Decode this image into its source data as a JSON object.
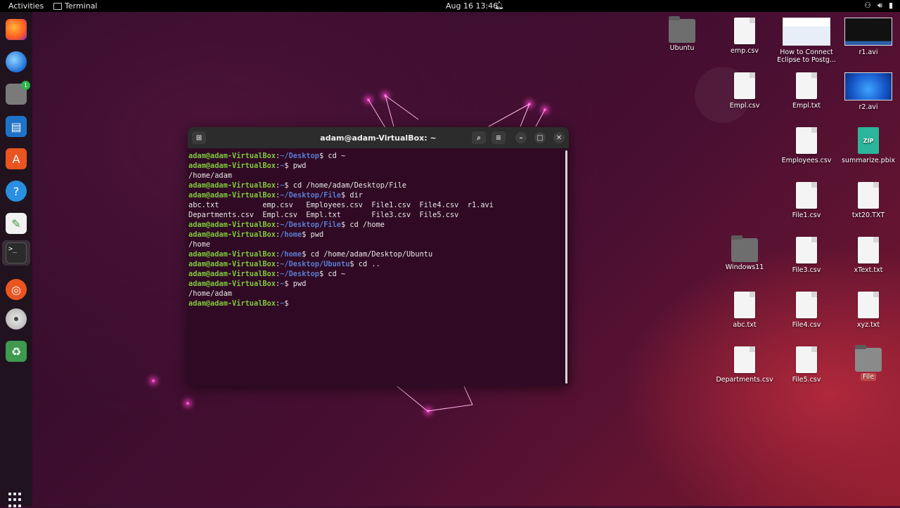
{
  "topbar": {
    "activities": "Activities",
    "app_name": "Terminal",
    "clock": "Aug 16  13:46"
  },
  "dock": {
    "items": [
      {
        "name": "firefox",
        "icon": "firefox-icon"
      },
      {
        "name": "thunderbird",
        "icon": "mail-icon"
      },
      {
        "name": "files",
        "icon": "files-icon",
        "badge": "1"
      },
      {
        "name": "writer",
        "icon": "writer-icon"
      },
      {
        "name": "software",
        "icon": "software-icon"
      },
      {
        "name": "help",
        "icon": "help-icon"
      },
      {
        "name": "text-editor",
        "icon": "text-editor-icon"
      },
      {
        "name": "terminal",
        "icon": "terminal-icon"
      },
      {
        "name": "ubuntu-pro",
        "icon": "ubuntu-icon"
      },
      {
        "name": "disc",
        "icon": "disc-icon"
      },
      {
        "name": "trash",
        "icon": "trash-icon"
      }
    ]
  },
  "terminal": {
    "title": "adam@adam-VirtualBox: ~",
    "lines": [
      {
        "user": "adam@adam-VirtualBox",
        "sep": ":",
        "path": "~/Desktop",
        "cmd": "$ cd ~"
      },
      {
        "user": "adam@adam-VirtualBox",
        "sep": ":",
        "path": "~",
        "cmd": "$ pwd"
      },
      {
        "text": "/home/adam"
      },
      {
        "user": "adam@adam-VirtualBox",
        "sep": ":",
        "path": "~",
        "cmd": "$ cd /home/adam/Desktop/File"
      },
      {
        "user": "adam@adam-VirtualBox",
        "sep": ":",
        "path": "~/Desktop/File",
        "cmd": "$ dir"
      },
      {
        "text": "abc.txt          emp.csv   Employees.csv  File1.csv  File4.csv  r1.avi"
      },
      {
        "text": "Departments.csv  Empl.csv  Empl.txt       File3.csv  File5.csv"
      },
      {
        "user": "adam@adam-VirtualBox",
        "sep": ":",
        "path": "~/Desktop/File",
        "cmd": "$ cd /home"
      },
      {
        "user": "adam@adam-VirtualBox",
        "sep": ":",
        "path": "/home",
        "cmd": "$ pwd"
      },
      {
        "text": "/home"
      },
      {
        "user": "adam@adam-VirtualBox",
        "sep": ":",
        "path": "/home",
        "cmd": "$ cd /home/adam/Desktop/Ubuntu"
      },
      {
        "user": "adam@adam-VirtualBox",
        "sep": ":",
        "path": "~/Desktop/Ubuntu",
        "cmd": "$ cd .."
      },
      {
        "user": "adam@adam-VirtualBox",
        "sep": ":",
        "path": "~/Desktop",
        "cmd": "$ cd ~"
      },
      {
        "user": "adam@adam-VirtualBox",
        "sep": ":",
        "path": "~",
        "cmd": "$ pwd"
      },
      {
        "text": "/home/adam"
      },
      {
        "user": "adam@adam-VirtualBox",
        "sep": ":",
        "path": "~",
        "cmd": "$ "
      }
    ]
  },
  "desktop": {
    "icons": [
      {
        "label": "Ubuntu",
        "kind": "folder"
      },
      {
        "label": "emp.csv",
        "kind": "doc"
      },
      {
        "label": "How to Connect Eclipse to Postg...",
        "kind": "thumb-web"
      },
      {
        "label": "r1.avi",
        "kind": "thumb-dark"
      },
      {
        "label": "Empl.csv",
        "kind": "doc"
      },
      {
        "label": "Empl.txt",
        "kind": "doc"
      },
      {
        "label": "r2.avi",
        "kind": "thumb-win"
      },
      {
        "label": "Employees.csv",
        "kind": "doc"
      },
      {
        "label": "summarize.pbix",
        "kind": "zip",
        "glyph": "ZIP"
      },
      {
        "label": "File1.csv",
        "kind": "doc"
      },
      {
        "label": "txt20.TXT",
        "kind": "doc"
      },
      {
        "label": "Windows11",
        "kind": "folder"
      },
      {
        "label": "File3.csv",
        "kind": "doc"
      },
      {
        "label": "xText.txt",
        "kind": "doc"
      },
      {
        "label": "abc.txt",
        "kind": "doc"
      },
      {
        "label": "File4.csv",
        "kind": "doc"
      },
      {
        "label": "xyz.txt",
        "kind": "doc"
      },
      {
        "label": "Departments.csv",
        "kind": "doc"
      },
      {
        "label": "File5.csv",
        "kind": "doc"
      },
      {
        "label": "File",
        "kind": "folder",
        "selected": true
      }
    ]
  }
}
